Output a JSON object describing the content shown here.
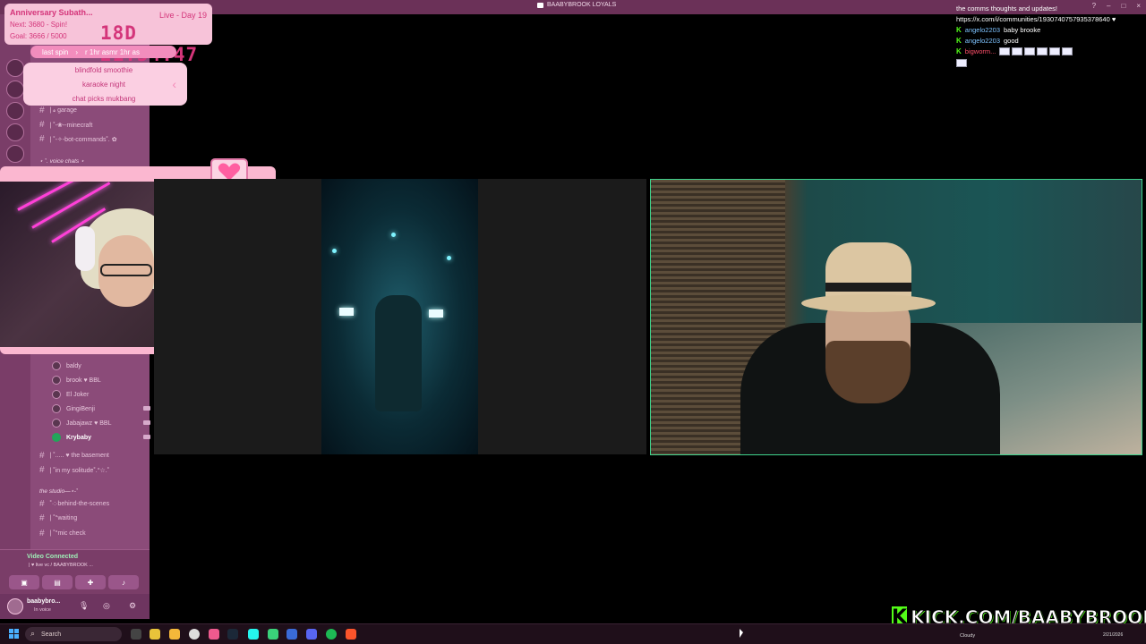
{
  "window": {
    "title": "BAABYBROOK LOYALS"
  },
  "subathon": {
    "title": "Anniversary Subath...",
    "next": "Next: 3680 - Spin!",
    "goal": "Goal: 3666 / 5000",
    "day": "Live - Day 19",
    "timer": "18D 21:54:47"
  },
  "spin": {
    "label": "last spin",
    "arrow": "›",
    "last_value": "r 1hr asmr 1hr as",
    "items": [
      "blindfold smoothie",
      "karaoke night",
      "chat picks mukbang"
    ]
  },
  "discord": {
    "channels": [
      {
        "name": "| 𝓼 garage"
      },
      {
        "name": "| ˚-❀--minecraft"
      },
      {
        "name": "| ˚-✧-bot-commands˚. ✿"
      }
    ],
    "voice_category": "⋆ ˚. voice chats ⋆",
    "voice_users": [
      {
        "name": "baldy"
      },
      {
        "name": "brook ♥ BBL"
      },
      {
        "name": "El Joker"
      },
      {
        "name": "GingiBenji"
      },
      {
        "name": "Jabajawz ♥ BBL"
      },
      {
        "name": "Krybaby"
      }
    ],
    "voice_channels": [
      {
        "name": "| ˚..... ♥ the basement"
      },
      {
        "name": "| ˚in my solitude˚.°☆.˚"
      }
    ],
    "studio_category": "the studio—⋆-˚",
    "studio_channels": [
      {
        "name": "˚·:·behind-the-scenes"
      },
      {
        "name": "| ˚°waiting"
      },
      {
        "name": "| ˚°mic check"
      }
    ],
    "voice_status": "Video Connected",
    "voice_sub": "| ♥ live vc / BAABYBROOK ...",
    "username": "baabybro...",
    "user_status": "In voice"
  },
  "chat": {
    "lines": [
      {
        "user": "",
        "text": "the comms thoughts and updates!"
      },
      {
        "user": "",
        "text": "https://x.com/i/communities/1930740757935378640 ♥"
      },
      {
        "user": "angelo2203",
        "text": "baby brooke"
      },
      {
        "user": "angelo2203",
        "text": "good"
      },
      {
        "user": "bigworm...",
        "text": ""
      }
    ]
  },
  "kick_banner": {
    "logo": "K",
    "text": "KICK.COM/BAABYBROOK"
  },
  "taskbar": {
    "search_placeholder": "Search",
    "weather": "Cloudy",
    "date": "2/21/2026"
  },
  "colors": {
    "sidebar": "#8b4b79",
    "accent_pink": "#d4357a",
    "kick_green": "#53fc18",
    "tile_border": "#3fd28c"
  },
  "icons": [
    "search-icon",
    "windows-start-icon",
    "mic-icon",
    "headphones-icon",
    "settings-icon",
    "camera-icon",
    "hash-icon",
    "heart-icon"
  ]
}
